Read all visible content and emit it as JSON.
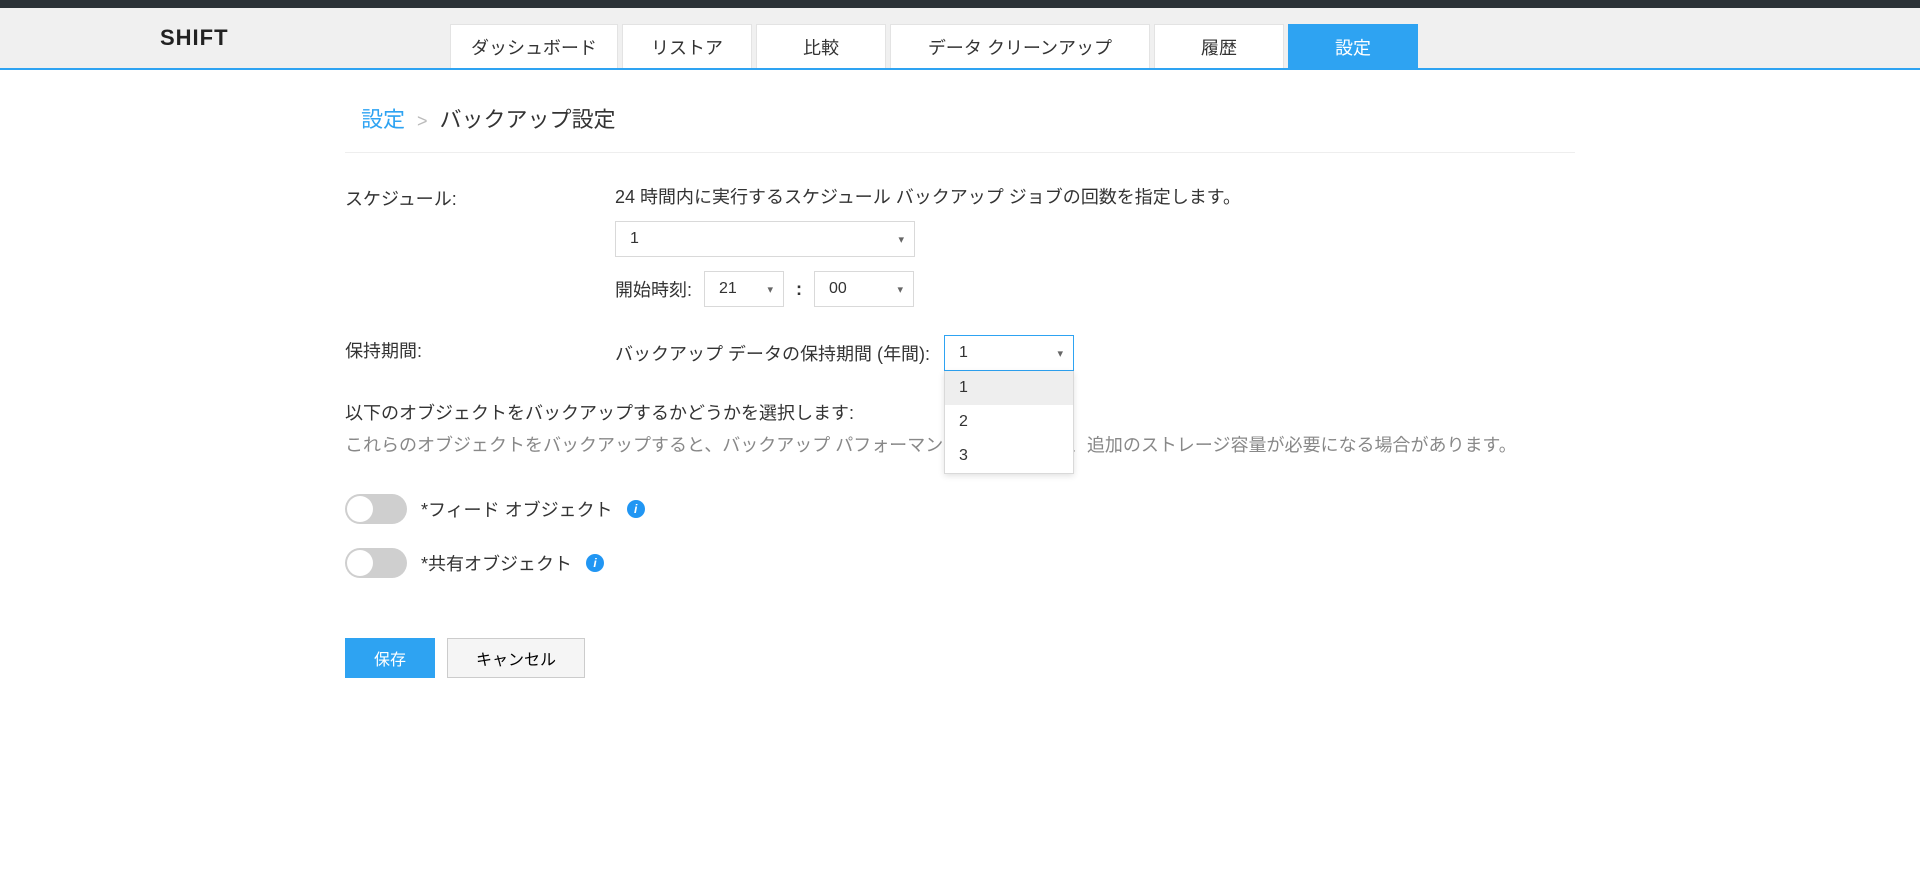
{
  "brand": "SHIFT",
  "tabs": {
    "dashboard": "ダッシュボード",
    "restore": "リストア",
    "compare": "比較",
    "cleanup": "データ クリーンアップ",
    "history": "履歴",
    "settings": "設定"
  },
  "active_tab": "settings",
  "breadcrumb": {
    "root": "設定",
    "sep": ">",
    "current": "バックアップ設定"
  },
  "schedule": {
    "label": "スケジュール:",
    "help": "24 時間内に実行するスケジュール バックアップ ジョブの回数を指定します。",
    "count_value": "1",
    "start_label": "開始時刻:",
    "hour_value": "21",
    "minute_value": "00",
    "colon": ":"
  },
  "retention": {
    "label": "保持期間:",
    "field_label": "バックアップ データの保持期間 (年間):",
    "value": "1",
    "options": [
      "1",
      "2",
      "3"
    ],
    "selected_index": 0
  },
  "objects": {
    "heading": "以下のオブジェクトをバックアップするかどうかを選択します:",
    "sub": "これらのオブジェクトをバックアップすると、バックアップ パフォーマンスに影響を与え、追加のストレージ容量が必要になる場合があります。",
    "toggles": [
      {
        "label": "*フィード オブジェクト",
        "on": false
      },
      {
        "label": "*共有オブジェクト",
        "on": false
      }
    ]
  },
  "actions": {
    "save": "保存",
    "cancel": "キャンセル"
  },
  "icons": {
    "info_glyph": "i",
    "chevron_glyph": "▾"
  }
}
